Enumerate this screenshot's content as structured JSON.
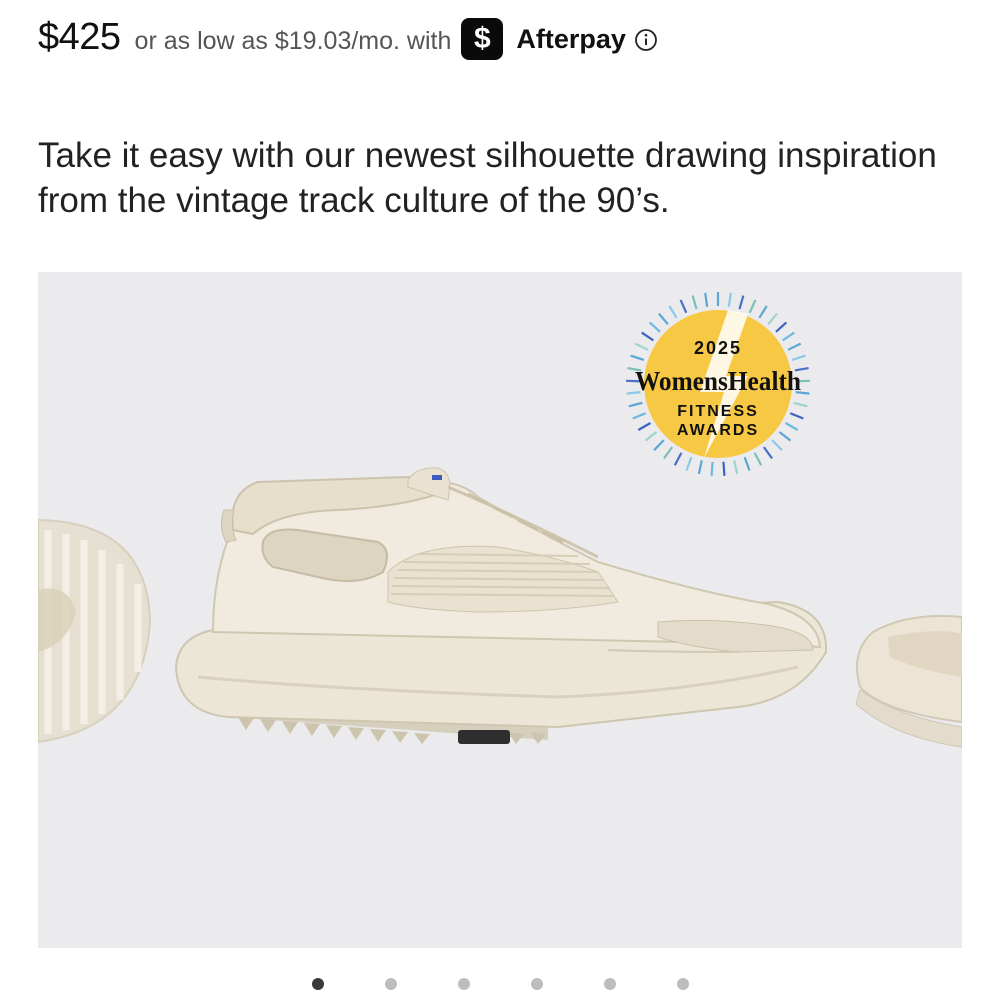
{
  "price": {
    "amount": "$425",
    "installment_text": "or as low as $19.03/mo. with"
  },
  "afterpay": {
    "badge_symbol": "$",
    "brand": "Afterpay",
    "info_icon": "info-circle-icon"
  },
  "description": "Take it easy with our newest silhouette drawing inspiration from the vintage track culture of the 90’s.",
  "gallery": {
    "background": "#ebebee",
    "award": {
      "year": "2025",
      "brand": "WomensHealth",
      "line1": "FITNESS",
      "line2": "AWARDS"
    },
    "dots": {
      "count": 6,
      "active_index": 0
    }
  },
  "colors": {
    "shoe": "#ece5d5",
    "award_yellow": "#f7c843"
  }
}
